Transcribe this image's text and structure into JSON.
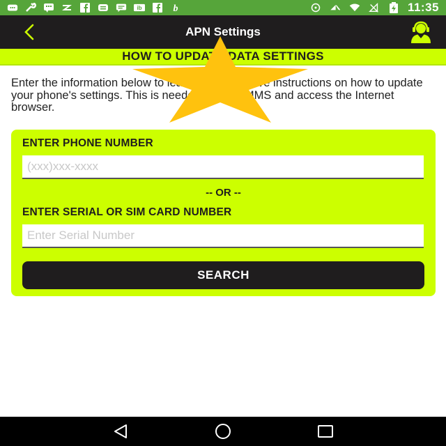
{
  "status_bar": {
    "time": "11:35",
    "icons": [
      "message-icon",
      "wrench-icon",
      "bbm-icon",
      "app-icon",
      "facebook-icon",
      "app-icon",
      "chat-icon",
      "ib-icon",
      "facebook-icon",
      "b-icon",
      "sync-icon",
      "no-signal-icon",
      "wifi-icon",
      "no-sim-icon",
      "battery-icon"
    ],
    "color": "#56a53a"
  },
  "app_bar": {
    "title": "APN Settings",
    "back_icon": "back-chevron-icon",
    "support_icon": "support-agent-icon",
    "background": "#1f1d1e",
    "accent": "#ccff00"
  },
  "section": {
    "title": "HOW TO UPDATE DATA SETTINGS"
  },
  "intro": {
    "text": "Enter the information below to learn how to receive instructions on how to update your phone's settings. This is needed to send MMS and access the Internet browser."
  },
  "form": {
    "phone_label": "ENTER PHONE NUMBER",
    "phone_placeholder": "(xxx)xxx-xxxx",
    "phone_value": "",
    "or_text": "-- OR --",
    "serial_label": "ENTER SERIAL OR SIM CARD NUMBER",
    "serial_placeholder": "Enter Serial Number",
    "serial_value": "",
    "search_label": "SEARCH"
  },
  "overlay": {
    "icon": "star-icon",
    "color": "#ffc20e"
  },
  "nav_bar": {
    "items": [
      "back-triangle-icon",
      "home-circle-icon",
      "recents-square-icon"
    ]
  }
}
